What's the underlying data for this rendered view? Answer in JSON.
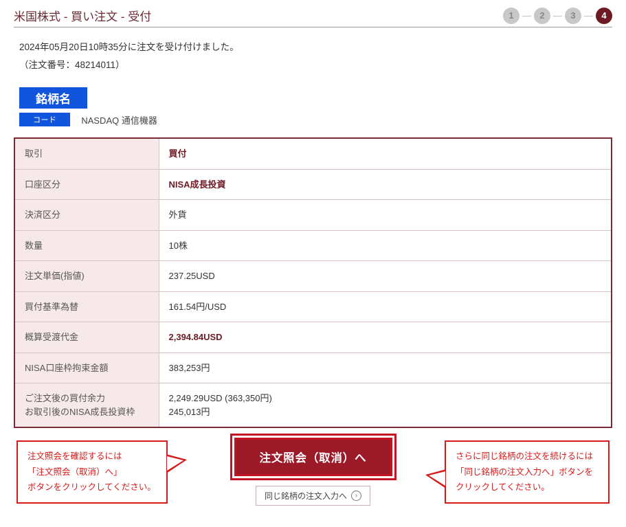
{
  "title": "米国株式 - 買い注文 - 受付",
  "stepper": {
    "steps": [
      "1",
      "2",
      "3",
      "4"
    ],
    "current_index": 3
  },
  "receipt": {
    "message": "2024年05月20日10時35分に注文を受け付けました。",
    "order_no_label": "（注文番号：48214011）"
  },
  "stock": {
    "name": "銘柄名",
    "code": "コード",
    "market": "NASDAQ 通信機器"
  },
  "details": {
    "rows": [
      {
        "label": "取引",
        "value": "買付",
        "emph": true
      },
      {
        "label": "口座区分",
        "value": "NISA成長投資",
        "emph": true
      },
      {
        "label": "決済区分",
        "value": "外貨",
        "emph": false
      },
      {
        "label": "数量",
        "value": "10株",
        "emph": false
      },
      {
        "label": "注文単価(指値)",
        "value": "237.25USD",
        "emph": false
      },
      {
        "label": "買付基準為替",
        "value": "161.54円/USD",
        "emph": false
      },
      {
        "label": "概算受渡代金",
        "value": "2,394.84USD",
        "emph": true
      },
      {
        "label": "NISA口座枠拘束金額",
        "value": "383,253円",
        "emph": false
      },
      {
        "label": "ご注文後の買付余力\nお取引後のNISA成長投資枠",
        "value": "2,249.29USD (363,350円)\n245,013円",
        "emph": false
      }
    ]
  },
  "buttons": {
    "primary": "注文照会（取消）へ",
    "secondary": "同じ銘柄の注文入力へ"
  },
  "callouts": {
    "left": "注文照会を確認するには\n「注文照会（取消）へ」\nボタンをクリックしてください。",
    "right": "さらに同じ銘柄の注文を続けるには\n「同じ銘柄の注文入力へ」ボタンを\nクリックしてください。"
  }
}
